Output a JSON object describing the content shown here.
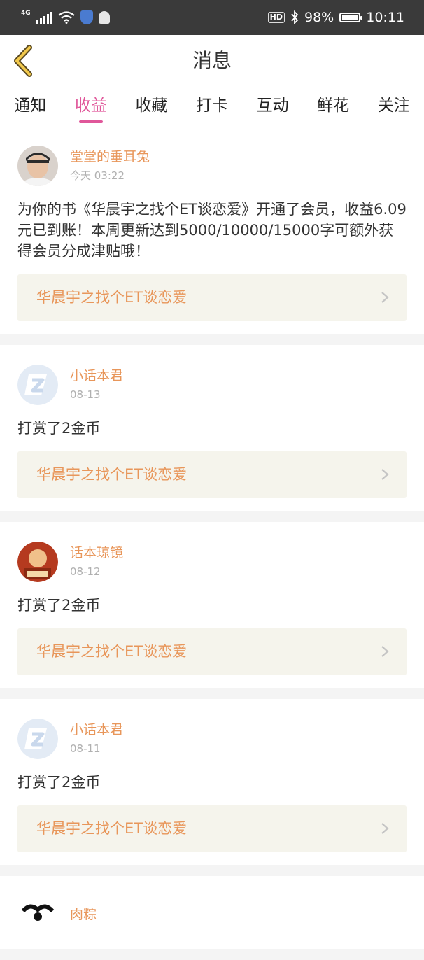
{
  "status_bar": {
    "network": "4G",
    "battery": "98%",
    "battery_level": 0.98,
    "time": "10:11",
    "icons": [
      "signal-icon",
      "wifi-icon",
      "shield-icon",
      "qq-icon",
      "hd-icon",
      "bluetooth-icon",
      "battery-icon"
    ]
  },
  "header": {
    "title": "消息",
    "back_icon": "chevron-left-icon"
  },
  "tabs": [
    {
      "label": "通知"
    },
    {
      "label": "收益"
    },
    {
      "label": "收藏"
    },
    {
      "label": "打卡"
    },
    {
      "label": "互动"
    },
    {
      "label": "鲜花"
    },
    {
      "label": "关注"
    }
  ],
  "active_tab": "收益",
  "colors": {
    "accent": "#e0579a",
    "name": "#e8965a",
    "book_bg": "#f5f4ec",
    "statusbar": "#3a3a3a"
  },
  "feed": [
    {
      "user": "堂堂的垂耳兔",
      "time": "今天 03:22",
      "message": "为你的书《华晨宇之找个ET谈恋爱》开通了会员，收益6.09元已到账！本周更新达到5000/10000/15000字可额外获得会员分成津贴哦！",
      "book": "华晨宇之找个ET谈恋爱"
    },
    {
      "user": "小话本君",
      "time": "08-13",
      "message": "打赏了2金币",
      "book": "华晨宇之找个ET谈恋爱"
    },
    {
      "user": "话本琼镜",
      "time": "08-12",
      "message": "打赏了2金币",
      "book": "华晨宇之找个ET谈恋爱"
    },
    {
      "user": "小话本君",
      "time": "08-11",
      "message": "打赏了2金币",
      "book": "华晨宇之找个ET谈恋爱"
    },
    {
      "user": "肉粽",
      "time": "",
      "message": "",
      "book": ""
    }
  ]
}
